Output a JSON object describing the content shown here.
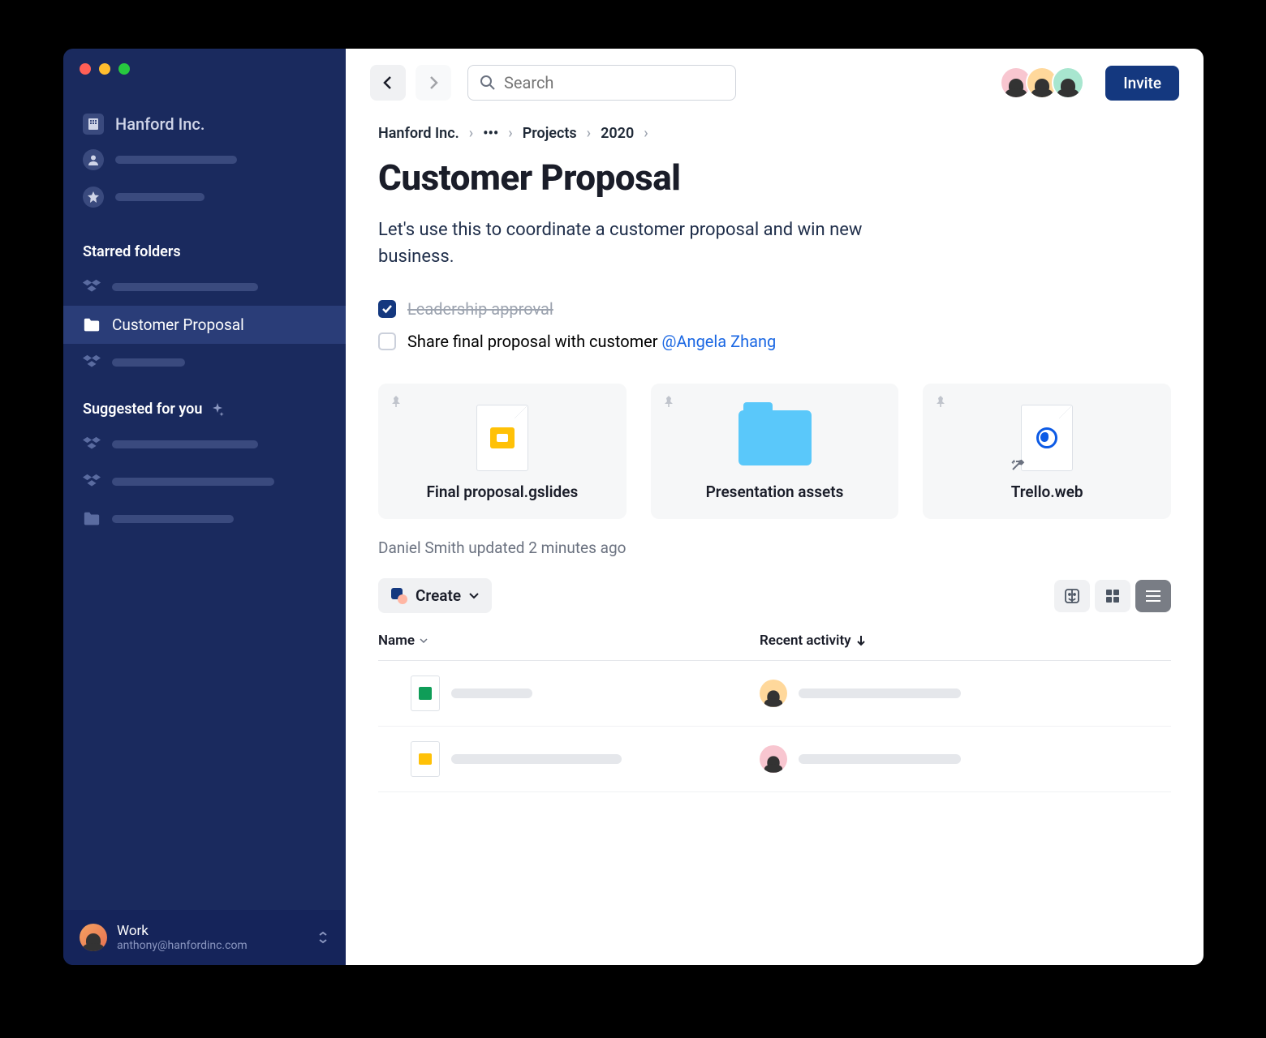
{
  "sidebar": {
    "company": "Hanford Inc.",
    "sections": {
      "starred": {
        "heading": "Starred folders",
        "active_item": "Customer Proposal"
      },
      "suggested": {
        "heading": "Suggested for you"
      }
    },
    "footer": {
      "workspace": "Work",
      "email": "anthony@hanfordinc.com"
    }
  },
  "topbar": {
    "search_placeholder": "Search",
    "invite_label": "Invite"
  },
  "breadcrumb": {
    "root": "Hanford Inc.",
    "ellipsis": "•••",
    "projects": "Projects",
    "year": "2020"
  },
  "page": {
    "title": "Customer Proposal",
    "description": "Let's use this to coordinate a customer proposal and win new business.",
    "tasks": [
      {
        "text": "Leadership approval",
        "done": true
      },
      {
        "text": "Share final proposal with customer ",
        "mention": "@Angela Zhang",
        "done": false
      }
    ],
    "cards": [
      {
        "title": "Final proposal.gslides"
      },
      {
        "title": "Presentation assets"
      },
      {
        "title": "Trello.web"
      }
    ],
    "updated_text": "Daniel Smith updated 2 minutes ago"
  },
  "toolbar": {
    "create_label": "Create"
  },
  "table": {
    "columns": {
      "name": "Name",
      "activity": "Recent activity"
    }
  }
}
